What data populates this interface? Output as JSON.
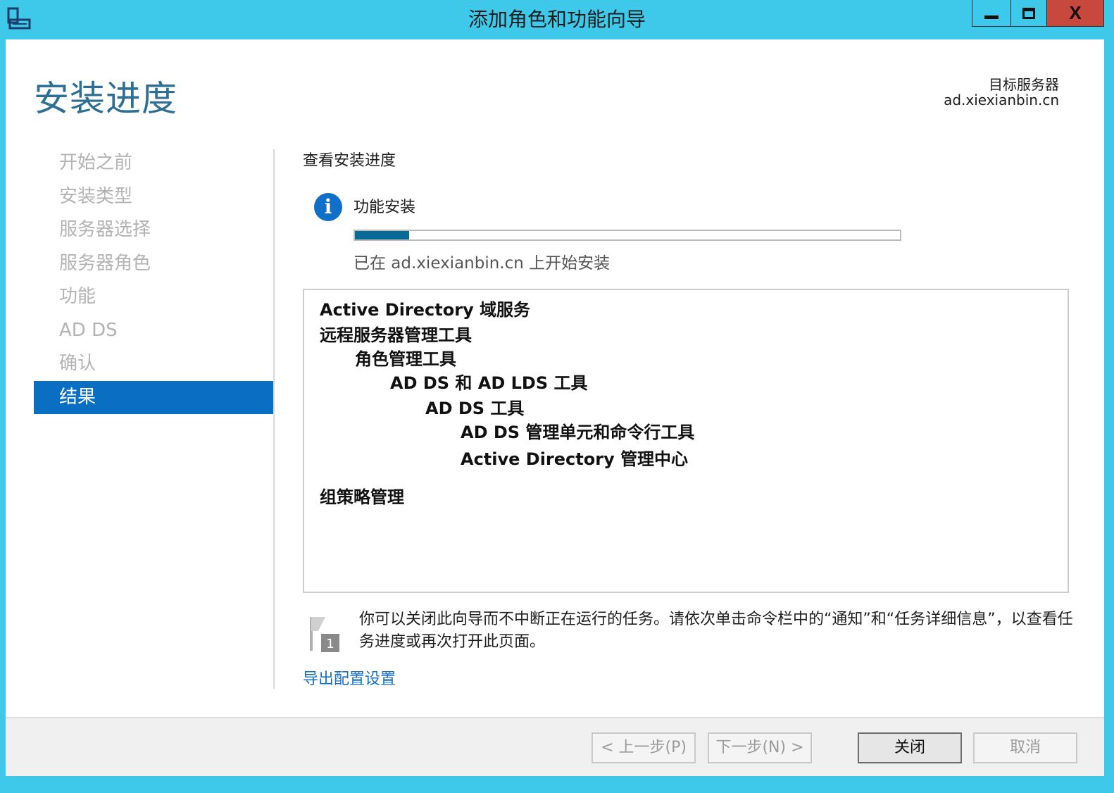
{
  "window": {
    "title": "添加角色和功能向导",
    "close_glyph": "X"
  },
  "header": {
    "page_title": "安装进度",
    "target_server_label": "目标服务器",
    "target_server_value": "ad.xiexianbin.cn"
  },
  "nav": {
    "items": [
      {
        "label": "开始之前",
        "active": false
      },
      {
        "label": "安装类型",
        "active": false
      },
      {
        "label": "服务器选择",
        "active": false
      },
      {
        "label": "服务器角色",
        "active": false
      },
      {
        "label": "功能",
        "active": false
      },
      {
        "label": "AD DS",
        "active": false
      },
      {
        "label": "确认",
        "active": false
      },
      {
        "label": "结果",
        "active": true
      }
    ]
  },
  "content": {
    "section_heading": "查看安装进度",
    "info_glyph": "i",
    "status_label": "功能安装",
    "progress_fraction": 0.1,
    "progress_note": "已在 ad.xiexianbin.cn 上开始安装",
    "results": [
      {
        "text": "Active Directory 域服务",
        "level": 0
      },
      {
        "text": "远程服务器管理工具",
        "level": 0
      },
      {
        "text": "角色管理工具",
        "level": 1
      },
      {
        "text": "AD DS 和 AD LDS 工具",
        "level": 2
      },
      {
        "text": "AD DS 工具",
        "level": 3
      },
      {
        "text": "AD DS 管理单元和命令行工具",
        "level": 4
      },
      {
        "text": "Active Directory 管理中心",
        "level": 4
      },
      {
        "text": "组策略管理",
        "level": 0
      }
    ],
    "note_badge": "1",
    "note_text": "你可以关闭此向导而不中断正在运行的任务。请依次单击命令栏中的“通知”和“任务详细信息”，以查看任务进度或再次打开此页面。",
    "export_link": "导出配置设置"
  },
  "footer": {
    "prev_label": "< 上一步(P)",
    "next_label": "下一步(N) >",
    "close_label": "关闭",
    "cancel_label": "取消"
  }
}
